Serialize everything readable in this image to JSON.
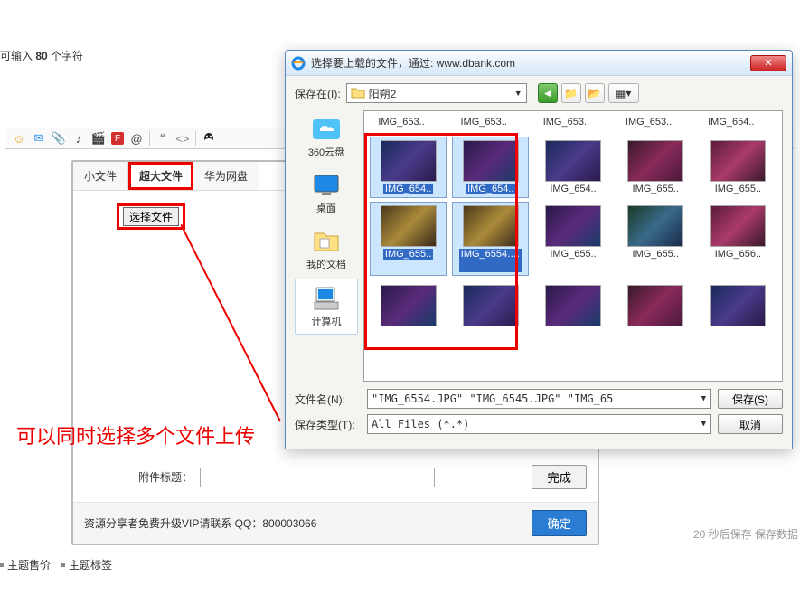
{
  "hint": {
    "prefix": "可输入 ",
    "num": "80",
    "suffix": " 个字符"
  },
  "toolbar": {
    "icons": [
      "smile",
      "envelope",
      "clip",
      "music",
      "film",
      "flash",
      "at",
      "quote",
      "code",
      "qq"
    ]
  },
  "upload": {
    "tabs": [
      "小文件",
      "超大文件",
      "华为网盘"
    ],
    "active_tab": 1,
    "choose_label": "选择文件",
    "attach_label": "附件标题：",
    "done_label": "完成",
    "vip_text": "资源分享者免费升级VIP请联系 QQ：800003066",
    "ok_label": "确定"
  },
  "annotation": "可以同时选择多个文件上传",
  "save_hint": "20 秒后保存 保存数据",
  "bottom": {
    "price": "主题售价",
    "tags": "主题标签"
  },
  "dialog": {
    "title": "选择要上载的文件，通过: www.dbank.com",
    "save_in_label": "保存在(I):",
    "folder_name": "阳朔2",
    "sidebar": [
      {
        "icon": "cloud",
        "label": "360云盘"
      },
      {
        "icon": "desktop",
        "label": "桌面"
      },
      {
        "icon": "docs",
        "label": "我的文档"
      },
      {
        "icon": "computer",
        "label": "计算机"
      }
    ],
    "row1_names": [
      "IMG_653..",
      "IMG_653..",
      "IMG_653..",
      "IMG_653..",
      "IMG_654.."
    ],
    "row2": [
      {
        "name": "IMG_654..",
        "t": "t1",
        "sel": true
      },
      {
        "name": "IMG_654..",
        "t": "t2",
        "sel": true
      },
      {
        "name": "IMG_654..",
        "t": "t1",
        "sel": false
      },
      {
        "name": "IMG_655..",
        "t": "t3",
        "sel": false
      },
      {
        "name": "IMG_655..",
        "t": "t4",
        "sel": false
      }
    ],
    "row3": [
      {
        "name": "IMG_655..",
        "t": "t6",
        "sel": true
      },
      {
        "name": "IMG_6554.JPG",
        "t": "t6",
        "sel": true,
        "two": true
      },
      {
        "name": "IMG_655..",
        "t": "t2",
        "sel": false
      },
      {
        "name": "IMG_655..",
        "t": "t5",
        "sel": false
      },
      {
        "name": "IMG_656..",
        "t": "t4",
        "sel": false
      }
    ],
    "row4_thumbs": [
      "t2",
      "t1",
      "t2",
      "t3",
      "t1"
    ],
    "filename_label": "文件名(N):",
    "filename_value": "\"IMG_6554.JPG\" \"IMG_6545.JPG\" \"IMG_65",
    "filetype_label": "保存类型(T):",
    "filetype_value": "All Files (*.*)",
    "save_btn": "保存(S)",
    "cancel_btn": "取消"
  }
}
